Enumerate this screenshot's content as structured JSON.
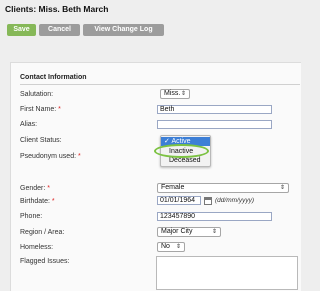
{
  "page": {
    "title": "Clients: Miss. Beth March"
  },
  "toolbar": {
    "save_label": "Save",
    "cancel_label": "Cancel",
    "log_label": "View Change Log"
  },
  "section": {
    "title": "Contact Information"
  },
  "form": {
    "salutation_label": "Salutation:",
    "salutation_value": "Miss.",
    "first_name_label": "First Name:",
    "first_name_value": "Beth",
    "alias_label": "Alias:",
    "alias_value": "",
    "client_status_label": "Client Status:",
    "client_status_options": [
      "Active",
      "Inactive",
      "Deceased"
    ],
    "client_status_selected": "Active",
    "client_status_checkmark": "✓",
    "pseudonym_label": "Pseudonym used:",
    "birthdate_label": "Birthdate:",
    "birthdate_value": "01/01/1964",
    "birthdate_hint": "(dd/mm/yyyy)",
    "gender_label": "Gender:",
    "gender_value": "Female",
    "phone_label": "Phone:",
    "phone_value": "123457890",
    "region_label": "Region / Area:",
    "region_value": "Major City",
    "homeless_label": "Homeless:",
    "homeless_value": "No",
    "flagged_label": "Flagged Issues:",
    "required_marker": "*"
  },
  "icons": {
    "select_arrow": "updown-arrow-icon",
    "calendar": "calendar-icon"
  },
  "colors": {
    "save": "#86b858",
    "neutral_button": "#9c9c9c",
    "selection": "#3d7fd6",
    "highlight": "#7cc242",
    "required": "#dd2222"
  }
}
